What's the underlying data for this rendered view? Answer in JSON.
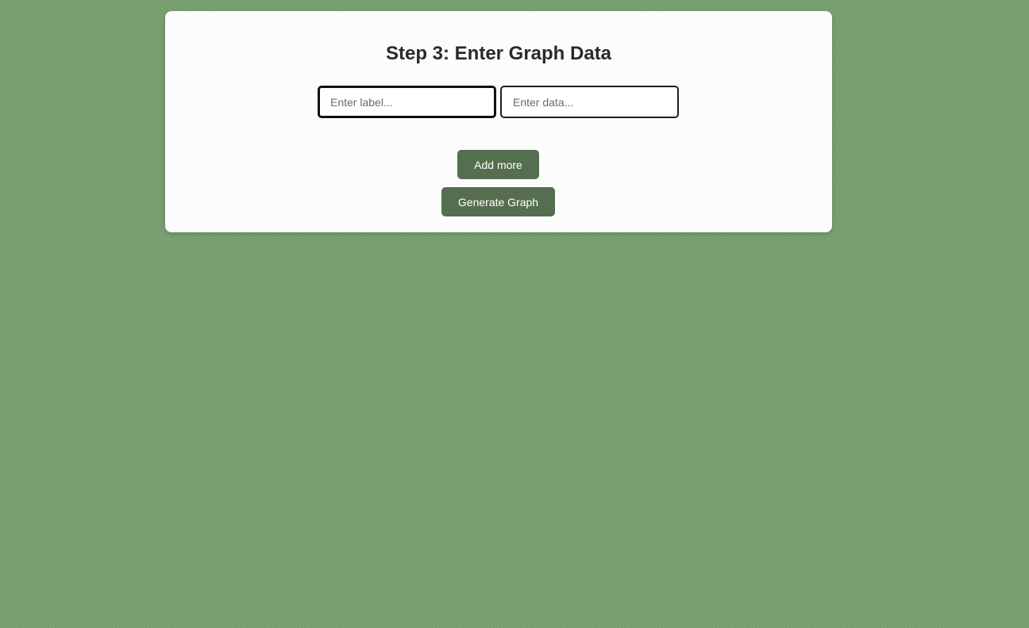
{
  "page": {
    "background_color": "#78a070"
  },
  "card": {
    "title": "Step 3: Enter Graph Data",
    "label_input": {
      "placeholder": "Enter label...",
      "value": ""
    },
    "data_input": {
      "placeholder": "Enter data...",
      "value": ""
    },
    "add_more_label": "Add more",
    "generate_label": "Generate Graph",
    "button_color": "#566e50"
  }
}
